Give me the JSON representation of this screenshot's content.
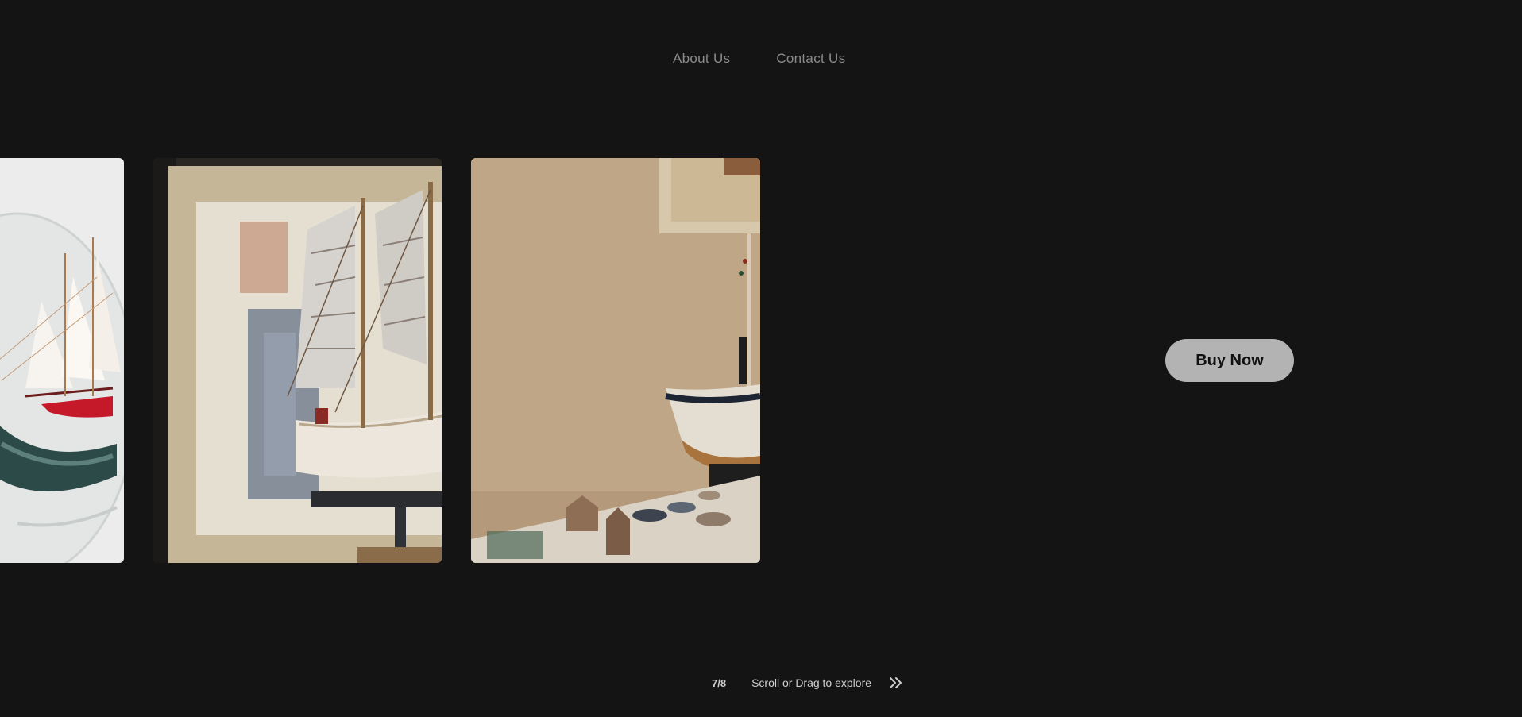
{
  "nav": {
    "about_label": "About Us",
    "contact_label": "Contact Us"
  },
  "cta": {
    "buy_label": "Buy Now"
  },
  "gallery": {
    "counter": "7/8",
    "hint": "Scroll or Drag to explore",
    "images": [
      {
        "name": "ship-in-bottle-photo"
      },
      {
        "name": "model-sailing-ship-photo"
      },
      {
        "name": "model-boat-on-shelf-photo"
      }
    ]
  },
  "colors": {
    "background": "#141414",
    "nav_text": "#8a8a8a",
    "button_bg": "#b3b3b3",
    "button_text": "#111111"
  },
  "icons": {
    "scroll_hint": "double-chevron-right-icon"
  }
}
